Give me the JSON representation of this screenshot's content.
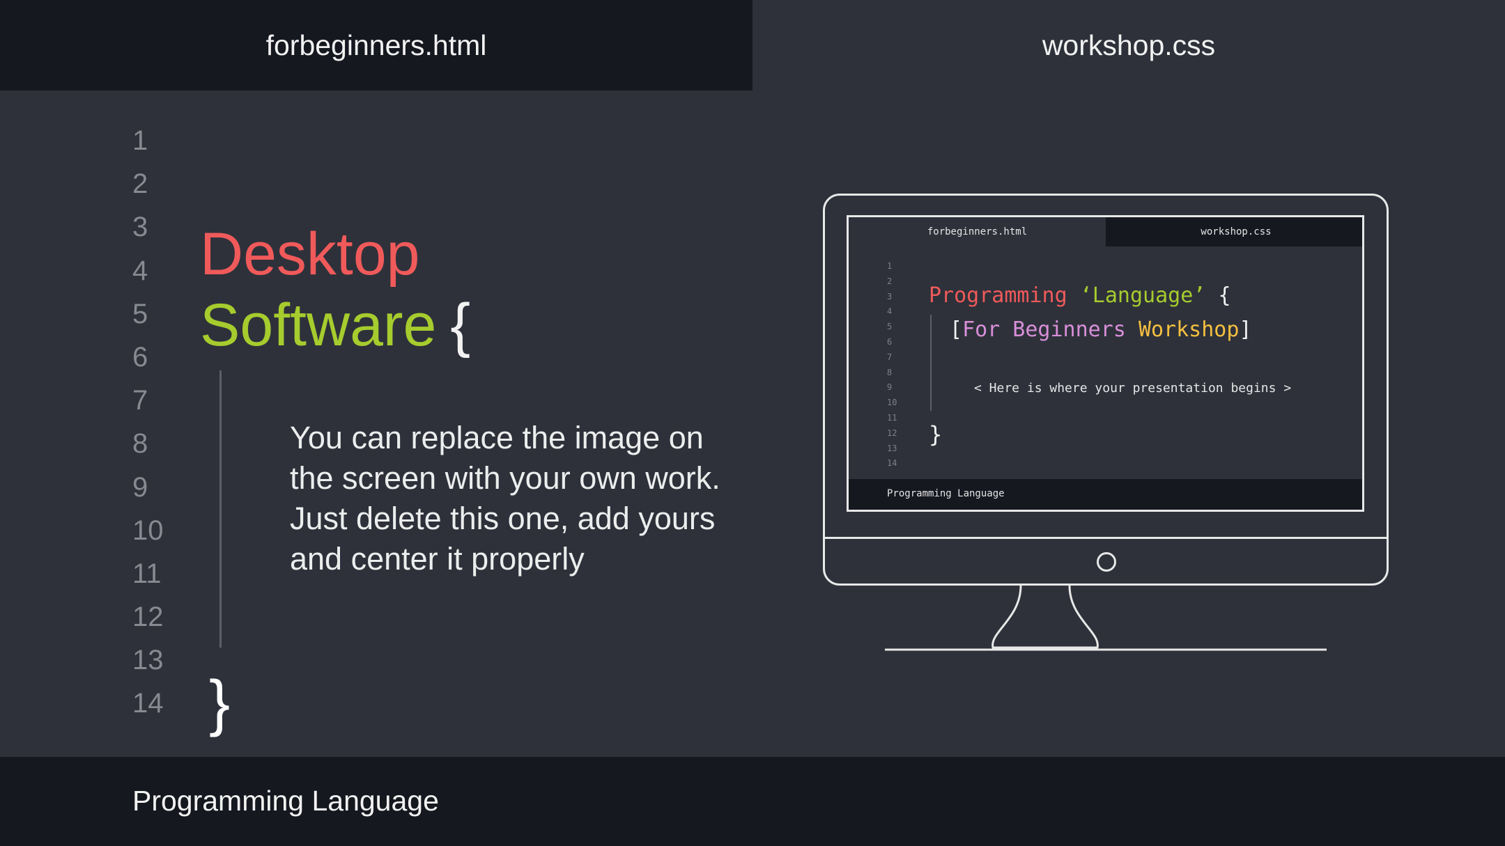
{
  "tabs": {
    "html_label": "forbeginners.html",
    "css_label": "workshop.css"
  },
  "gutter": [
    "1",
    "2",
    "3",
    "4",
    "5",
    "6",
    "7",
    "8",
    "9",
    "10",
    "11",
    "12",
    "13",
    "14"
  ],
  "title": {
    "line1": "Desktop",
    "line2": "Software",
    "open_brace": "{",
    "close_brace": "}"
  },
  "body_text": "You can replace the image on the screen with your own work. Just delete this one, add yours and center it properly",
  "footer": {
    "label": "Programming Language"
  },
  "monitor": {
    "tab_html": "forbeginners.html",
    "tab_css": "workshop.css",
    "gutter": [
      "1",
      "2",
      "3",
      "4",
      "5",
      "6",
      "7",
      "8",
      "9",
      "10",
      "11",
      "12",
      "13",
      "14"
    ],
    "code_line1": {
      "keyword": "Programming",
      "string": "‘Language’",
      "brace": "{"
    },
    "code_line2": {
      "bracket_open": "[",
      "part1": "For Beginners",
      "part2": "Workshop",
      "bracket_close": "]"
    },
    "note": "< Here is where your presentation begins >",
    "close_brace": "}",
    "footer": "Programming Language"
  },
  "colors": {
    "background": "#2e313a",
    "bar": "#161820",
    "red": "#f05a5a",
    "green": "#a6cc2e",
    "pink": "#d88fd8",
    "yellow": "#f5c040"
  }
}
